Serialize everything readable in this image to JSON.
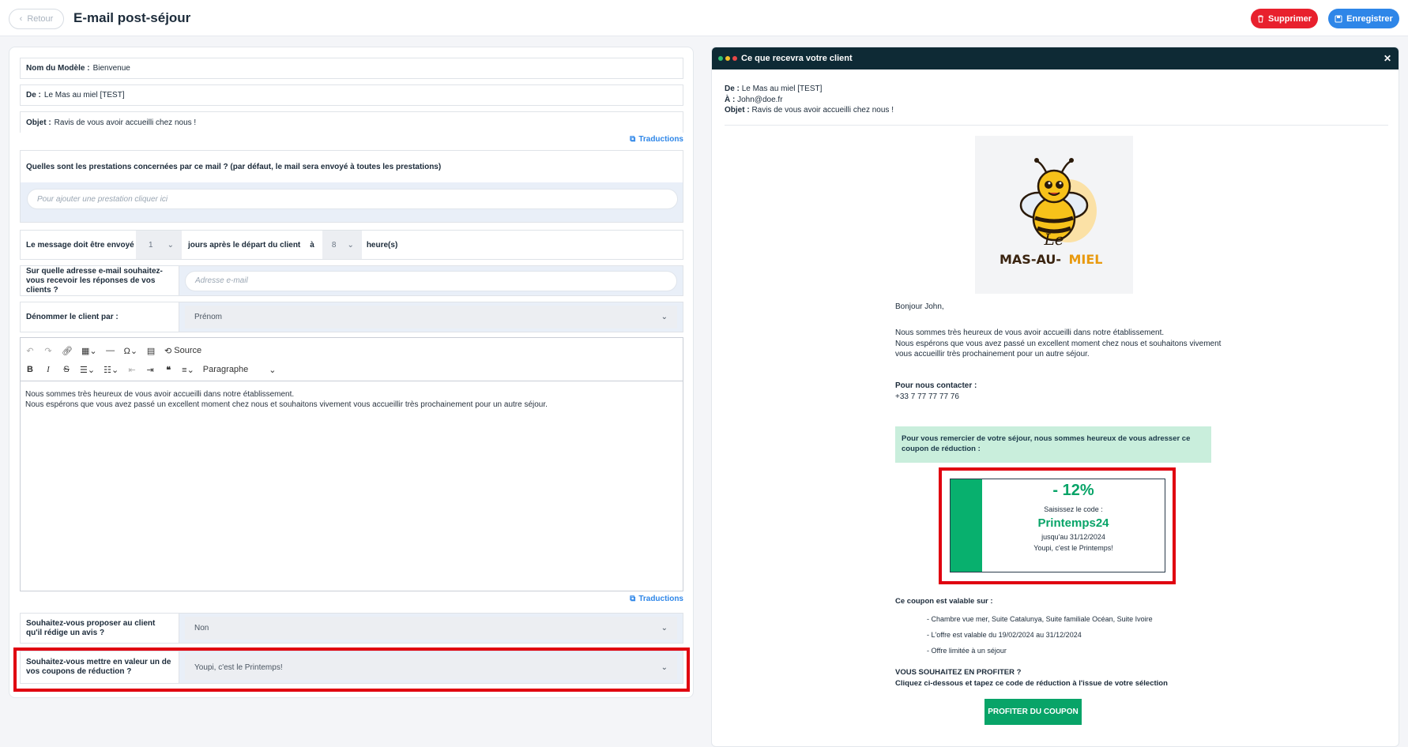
{
  "header": {
    "back_label": "Retour",
    "title": "E-mail post-séjour",
    "delete_label": "Supprimer",
    "save_label": "Enregistrer"
  },
  "form": {
    "model_name": {
      "label": "Nom du Modèle :",
      "value": "Bienvenue"
    },
    "from": {
      "label": "De :",
      "value": "Le Mas au miel [TEST]"
    },
    "subject": {
      "label": "Objet :",
      "value": "Ravis de vous avoir accueilli chez nous !"
    },
    "translations_label": "Traductions",
    "services_question": "Quelles sont les prestations concernées par ce mail ? (par défaut, le mail sera envoyé à toutes les prestations)",
    "services_placeholder": "Pour ajouter une prestation cliquer ici",
    "send_timing": {
      "label": "Le message doit être envoyé",
      "days_value": "1",
      "days_suffix": "jours après le départ du client",
      "at_label": "à",
      "hour_value": "8",
      "hour_suffix": "heure(s)"
    },
    "reply_email": {
      "label": "Sur quelle adresse e-mail souhaitez-vous recevoir les réponses de vos clients ?",
      "placeholder": "Adresse e-mail"
    },
    "client_naming": {
      "label": "Dénommer le client par :",
      "value": "Prénom"
    },
    "editor": {
      "source_label": "Source",
      "format_label": "Paragraphe",
      "line1": "Nous sommes très heureux de vous avoir accueilli dans notre établissement.",
      "line2": "Nous espérons que vous avez passé un excellent moment chez nous et souhaitons vivement vous accueillir très prochainement pour un autre séjour."
    },
    "review": {
      "label": "Souhaitez-vous proposer au client qu'il rédige un avis ?",
      "value": "Non"
    },
    "coupon": {
      "label": "Souhaitez-vous mettre en valeur un de vos coupons de réduction ?",
      "value": "Youpi, c'est le Printemps!"
    }
  },
  "preview": {
    "title": "Ce que recevra votre client",
    "dot_colors": [
      "#2fbf71",
      "#f5c02a",
      "#e94848"
    ],
    "from_label": "De :",
    "from_value": "Le Mas au miel [TEST]",
    "to_label": "À :",
    "to_value": "John@doe.fr",
    "subject_label": "Objet :",
    "subject_value": "Ravis de vous avoir accueilli chez nous !",
    "logo_top": "Le",
    "logo_left": "MAS-AU-",
    "logo_right": "MIEL",
    "greeting": "Bonjour John,",
    "body1": "Nous sommes très heureux de vous avoir accueilli dans notre établissement.",
    "body2": "Nous espérons que vous avez passé un excellent moment chez nous et souhaitons vivement",
    "body3": "vous accueillir très prochainement pour un autre séjour.",
    "contact_label": "Pour nous contacter :",
    "contact_phone": "+33 7 77 77 77 76",
    "coupon_intro": "Pour vous remercier de votre séjour, nous sommes heureux de vous adresser ce coupon de réduction :",
    "coupon_discount": "- 12%",
    "coupon_enter": "Saisissez le code :",
    "coupon_code": "Printemps24",
    "coupon_until": "jusqu'au 31/12/2024",
    "coupon_name": "Youpi, c'est le Printemps!",
    "valid_on_label": "Ce coupon est valable sur :",
    "valid_items": [
      "- Chambre vue mer, Suite Catalunya, Suite familiale Océan, Suite Ivoire",
      "- L'offre est valable du 19/02/2024 au 31/12/2024",
      "- Offre limitée à un séjour"
    ],
    "cta_title": "VOUS SOUHAITEZ EN PROFITER ?",
    "cta_sub": "Cliquez ci-dessous et tapez ce code de réduction à l'issue de votre sélection",
    "cta_button": "PROFITER DU COUPON"
  }
}
